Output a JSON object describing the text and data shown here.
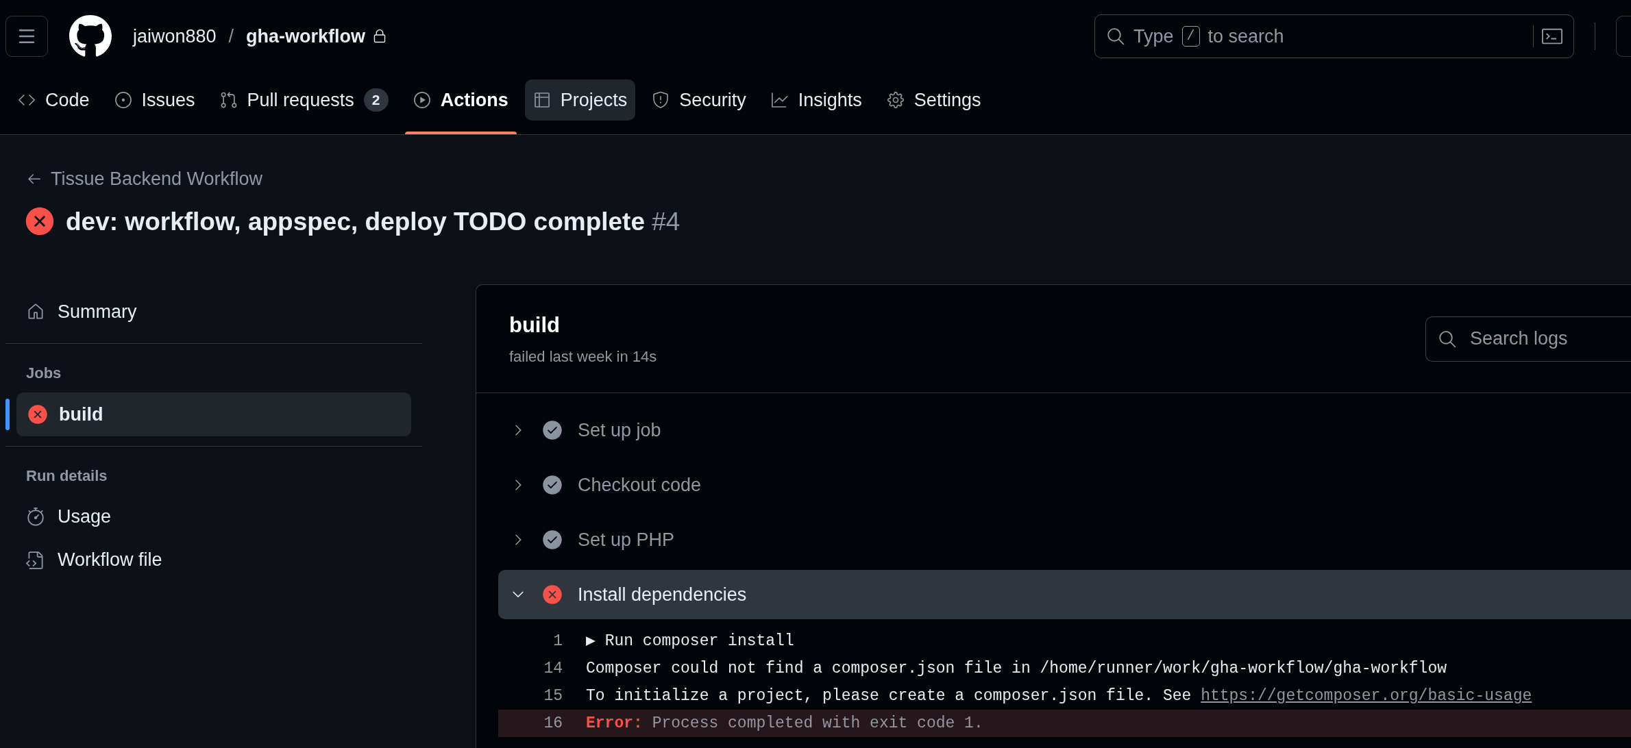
{
  "header": {
    "owner": "jaiwon880",
    "separator": "/",
    "repo": "gha-workflow",
    "search": {
      "before": "Type",
      "key": "/",
      "after": "to search"
    }
  },
  "tabs": [
    {
      "label": "Code",
      "selected": false,
      "hovered": false
    },
    {
      "label": "Issues",
      "selected": false,
      "hovered": false
    },
    {
      "label": "Pull requests",
      "count": "2",
      "selected": false,
      "hovered": false
    },
    {
      "label": "Actions",
      "selected": true,
      "hovered": false
    },
    {
      "label": "Projects",
      "selected": false,
      "hovered": true
    },
    {
      "label": "Security",
      "selected": false,
      "hovered": false
    },
    {
      "label": "Insights",
      "selected": false,
      "hovered": false
    },
    {
      "label": "Settings",
      "selected": false,
      "hovered": false
    }
  ],
  "run": {
    "back_link": "Tissue Backend Workflow",
    "failed": true,
    "title": "dev: workflow, appspec, deploy TODO complete",
    "number": "#4"
  },
  "sidebar": {
    "summary": "Summary",
    "jobs_heading": "Jobs",
    "jobs": [
      {
        "name": "build",
        "failed": true,
        "selected": true
      }
    ],
    "details_heading": "Run details",
    "details": [
      "Usage",
      "Workflow file"
    ]
  },
  "job": {
    "name": "build",
    "subtitle": "failed last week in 14s",
    "search_placeholder": "Search logs",
    "steps": [
      {
        "name": "Set up job",
        "failed": false,
        "expanded": false
      },
      {
        "name": "Checkout code",
        "failed": false,
        "expanded": false
      },
      {
        "name": "Set up PHP",
        "failed": false,
        "expanded": false
      },
      {
        "name": "Install dependencies",
        "failed": true,
        "expanded": true
      }
    ],
    "log": [
      {
        "number": "1",
        "kind": "group",
        "text": "▶ Run composer install"
      },
      {
        "number": "14",
        "kind": "plain",
        "text": "Composer could not find a composer.json file in /home/runner/work/gha-workflow/gha-workflow"
      },
      {
        "number": "15",
        "kind": "link",
        "text": "To initialize a project, please create a composer.json file. See",
        "link": "https://getcomposer.org/basic-usage"
      },
      {
        "number": "16",
        "kind": "error",
        "label": "Error:",
        "text": "Process completed with exit code 1."
      }
    ]
  }
}
